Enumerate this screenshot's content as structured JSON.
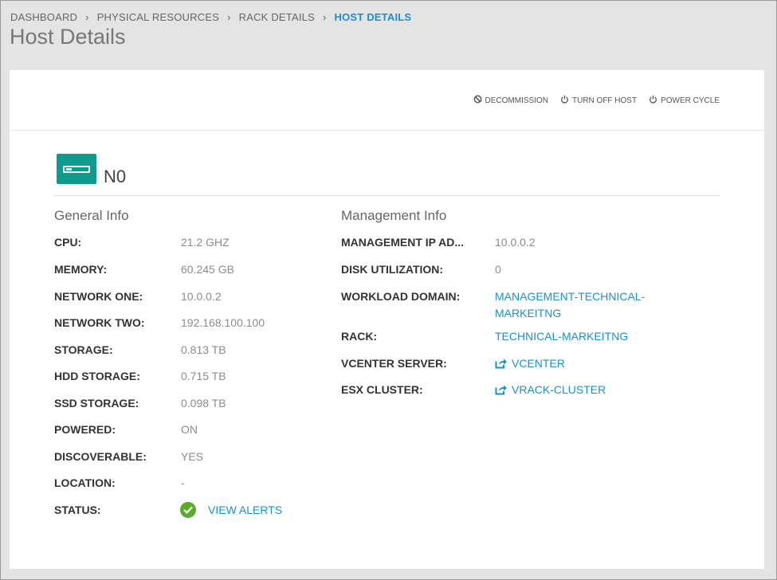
{
  "breadcrumb": {
    "items": [
      "DASHBOARD",
      "PHYSICAL RESOURCES",
      "RACK DETAILS",
      "HOST DETAILS"
    ],
    "separator": "›"
  },
  "page_title": "Host Details",
  "actions": {
    "decommission": "DECOMMISSION",
    "turn_off": "TURN OFF HOST",
    "power_cycle": "POWER CYCLE"
  },
  "host": {
    "name": "N0"
  },
  "general": {
    "title": "General Info",
    "rows": [
      {
        "label": "CPU:",
        "value": "21.2 GHZ"
      },
      {
        "label": "MEMORY:",
        "value": "60.245 GB"
      },
      {
        "label": "NETWORK ONE:",
        "value": "10.0.0.2"
      },
      {
        "label": "NETWORK TWO:",
        "value": "192.168.100.100"
      },
      {
        "label": "STORAGE:",
        "value": "0.813 TB"
      },
      {
        "label": "HDD STORAGE:",
        "value": "0.715 TB"
      },
      {
        "label": "SSD STORAGE:",
        "value": "0.098 TB"
      },
      {
        "label": "POWERED:",
        "value": "ON"
      },
      {
        "label": "DISCOVERABLE:",
        "value": "YES"
      },
      {
        "label": "LOCATION:",
        "value": "-"
      },
      {
        "label": "STATUS:",
        "value": "VIEW ALERTS"
      }
    ]
  },
  "management": {
    "title": "Management Info",
    "rows": [
      {
        "label": "MANAGEMENT IP AD...",
        "value": "10.0.0.2"
      },
      {
        "label": "DISK UTILIZATION:",
        "value": "0"
      },
      {
        "label": "WORKLOAD DOMAIN:",
        "value_line1": "MANAGEMENT-TECHNICAL-",
        "value_line2": "MARKEITNG"
      },
      {
        "label": "RACK:",
        "value": "TECHNICAL-MARKEITNG"
      },
      {
        "label": "VCENTER SERVER:",
        "value": "VCENTER"
      },
      {
        "label": "ESX CLUSTER:",
        "value": "VRACK-CLUSTER"
      }
    ]
  },
  "icons": {
    "decommission": "ban-icon",
    "turn_off": "power-icon",
    "power_cycle": "power-icon",
    "host": "server-icon",
    "status": "check-circle-icon",
    "external": "external-link-icon"
  },
  "colors": {
    "accent": "#1a90cf",
    "host_icon": "#0e9a8c",
    "status_ok": "#5aab2a",
    "background": "#e4e4e4"
  }
}
